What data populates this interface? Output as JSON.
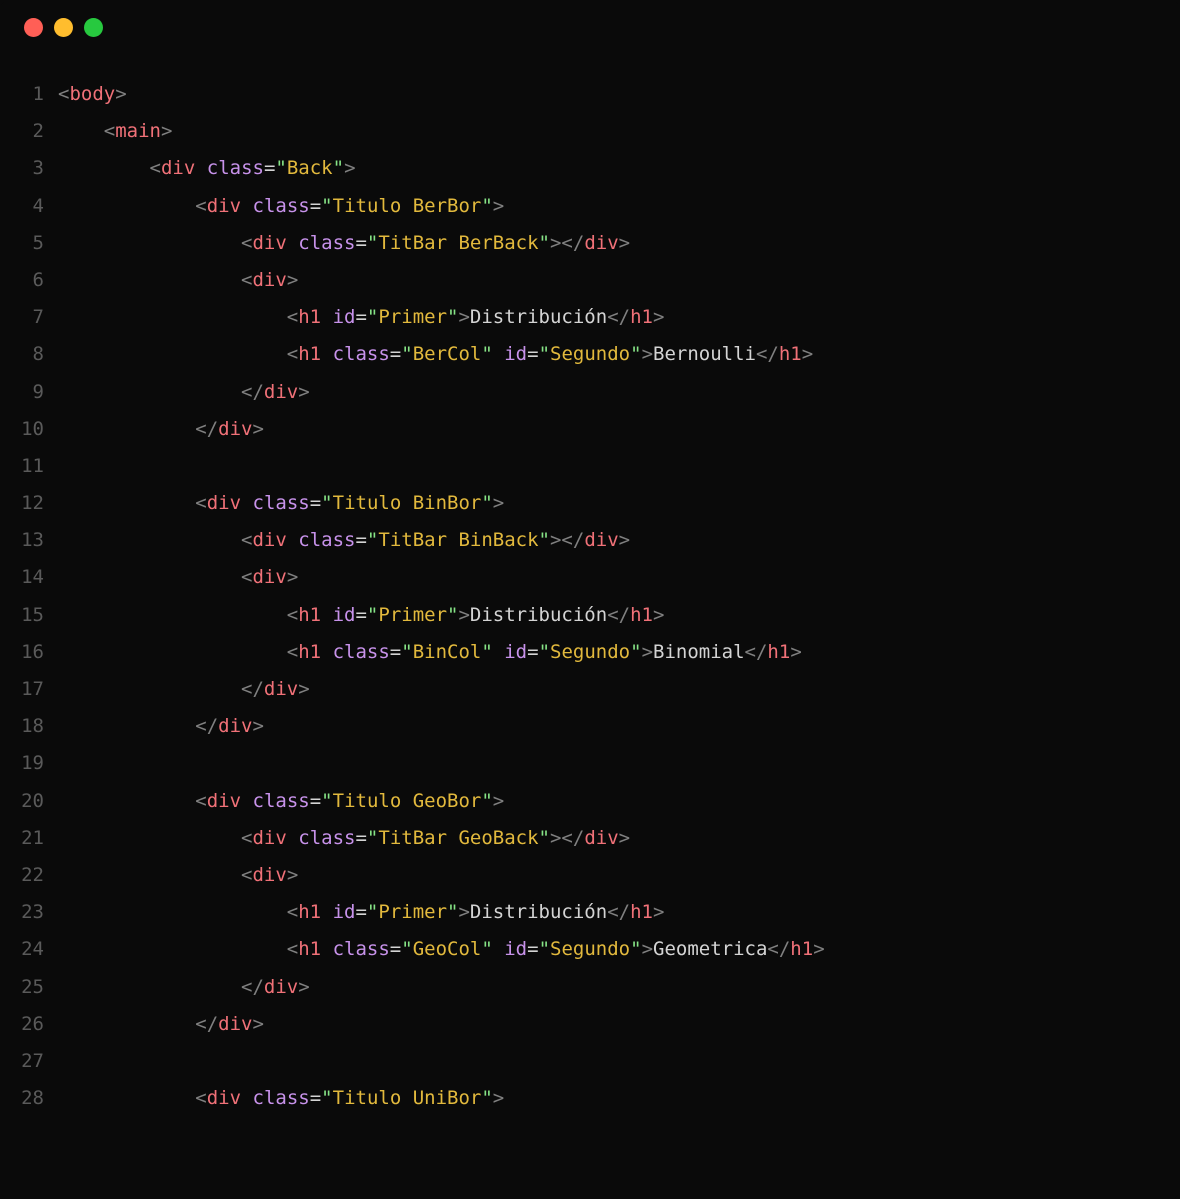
{
  "lines": [
    {
      "n": "1",
      "indent": 0,
      "tokens": [
        [
          "br",
          "<"
        ],
        [
          "tag",
          "body"
        ],
        [
          "br",
          ">"
        ]
      ]
    },
    {
      "n": "2",
      "indent": 1,
      "tokens": [
        [
          "br",
          "<"
        ],
        [
          "tag",
          "main"
        ],
        [
          "br",
          ">"
        ]
      ]
    },
    {
      "n": "3",
      "indent": 2,
      "tokens": [
        [
          "br",
          "<"
        ],
        [
          "tag",
          "div"
        ],
        [
          "txt",
          " "
        ],
        [
          "attn",
          "class"
        ],
        [
          "eq",
          "="
        ],
        [
          "q",
          "\""
        ],
        [
          "str",
          "Back"
        ],
        [
          "q",
          "\""
        ],
        [
          "br",
          ">"
        ]
      ]
    },
    {
      "n": "4",
      "indent": 3,
      "tokens": [
        [
          "br",
          "<"
        ],
        [
          "tag",
          "div"
        ],
        [
          "txt",
          " "
        ],
        [
          "attn",
          "class"
        ],
        [
          "eq",
          "="
        ],
        [
          "q",
          "\""
        ],
        [
          "str",
          "Titulo BerBor"
        ],
        [
          "q",
          "\""
        ],
        [
          "br",
          ">"
        ]
      ]
    },
    {
      "n": "5",
      "indent": 4,
      "tokens": [
        [
          "br",
          "<"
        ],
        [
          "tag",
          "div"
        ],
        [
          "txt",
          " "
        ],
        [
          "attn",
          "class"
        ],
        [
          "eq",
          "="
        ],
        [
          "q",
          "\""
        ],
        [
          "str",
          "TitBar BerBack"
        ],
        [
          "q",
          "\""
        ],
        [
          "br",
          "></"
        ],
        [
          "tag",
          "div"
        ],
        [
          "br",
          ">"
        ]
      ]
    },
    {
      "n": "6",
      "indent": 4,
      "tokens": [
        [
          "br",
          "<"
        ],
        [
          "tag",
          "div"
        ],
        [
          "br",
          ">"
        ]
      ]
    },
    {
      "n": "7",
      "indent": 5,
      "tokens": [
        [
          "br",
          "<"
        ],
        [
          "tag",
          "h1"
        ],
        [
          "txt",
          " "
        ],
        [
          "attn",
          "id"
        ],
        [
          "eq",
          "="
        ],
        [
          "q",
          "\""
        ],
        [
          "str",
          "Primer"
        ],
        [
          "q",
          "\""
        ],
        [
          "br",
          ">"
        ],
        [
          "txt",
          "Distribución"
        ],
        [
          "br",
          "</"
        ],
        [
          "tag",
          "h1"
        ],
        [
          "br",
          ">"
        ]
      ]
    },
    {
      "n": "8",
      "indent": 5,
      "tokens": [
        [
          "br",
          "<"
        ],
        [
          "tag",
          "h1"
        ],
        [
          "txt",
          " "
        ],
        [
          "attn",
          "class"
        ],
        [
          "eq",
          "="
        ],
        [
          "q",
          "\""
        ],
        [
          "str",
          "BerCol"
        ],
        [
          "q",
          "\""
        ],
        [
          "txt",
          " "
        ],
        [
          "attn",
          "id"
        ],
        [
          "eq",
          "="
        ],
        [
          "q",
          "\""
        ],
        [
          "str",
          "Segundo"
        ],
        [
          "q",
          "\""
        ],
        [
          "br",
          ">"
        ],
        [
          "txt",
          "Bernoulli"
        ],
        [
          "br",
          "</"
        ],
        [
          "tag",
          "h1"
        ],
        [
          "br",
          ">"
        ]
      ]
    },
    {
      "n": "9",
      "indent": 4,
      "tokens": [
        [
          "br",
          "</"
        ],
        [
          "tag",
          "div"
        ],
        [
          "br",
          ">"
        ]
      ]
    },
    {
      "n": "10",
      "indent": 3,
      "tokens": [
        [
          "br",
          "</"
        ],
        [
          "tag",
          "div"
        ],
        [
          "br",
          ">"
        ]
      ]
    },
    {
      "n": "11",
      "indent": 0,
      "tokens": []
    },
    {
      "n": "12",
      "indent": 3,
      "tokens": [
        [
          "br",
          "<"
        ],
        [
          "tag",
          "div"
        ],
        [
          "txt",
          " "
        ],
        [
          "attn",
          "class"
        ],
        [
          "eq",
          "="
        ],
        [
          "q",
          "\""
        ],
        [
          "str",
          "Titulo BinBor"
        ],
        [
          "q",
          "\""
        ],
        [
          "br",
          ">"
        ]
      ]
    },
    {
      "n": "13",
      "indent": 4,
      "tokens": [
        [
          "br",
          "<"
        ],
        [
          "tag",
          "div"
        ],
        [
          "txt",
          " "
        ],
        [
          "attn",
          "class"
        ],
        [
          "eq",
          "="
        ],
        [
          "q",
          "\""
        ],
        [
          "str",
          "TitBar BinBack"
        ],
        [
          "q",
          "\""
        ],
        [
          "br",
          "></"
        ],
        [
          "tag",
          "div"
        ],
        [
          "br",
          ">"
        ]
      ]
    },
    {
      "n": "14",
      "indent": 4,
      "tokens": [
        [
          "br",
          "<"
        ],
        [
          "tag",
          "div"
        ],
        [
          "br",
          ">"
        ]
      ]
    },
    {
      "n": "15",
      "indent": 5,
      "tokens": [
        [
          "br",
          "<"
        ],
        [
          "tag",
          "h1"
        ],
        [
          "txt",
          " "
        ],
        [
          "attn",
          "id"
        ],
        [
          "eq",
          "="
        ],
        [
          "q",
          "\""
        ],
        [
          "str",
          "Primer"
        ],
        [
          "q",
          "\""
        ],
        [
          "br",
          ">"
        ],
        [
          "txt",
          "Distribución"
        ],
        [
          "br",
          "</"
        ],
        [
          "tag",
          "h1"
        ],
        [
          "br",
          ">"
        ]
      ]
    },
    {
      "n": "16",
      "indent": 5,
      "tokens": [
        [
          "br",
          "<"
        ],
        [
          "tag",
          "h1"
        ],
        [
          "txt",
          " "
        ],
        [
          "attn",
          "class"
        ],
        [
          "eq",
          "="
        ],
        [
          "q",
          "\""
        ],
        [
          "str",
          "BinCol"
        ],
        [
          "q",
          "\""
        ],
        [
          "txt",
          " "
        ],
        [
          "attn",
          "id"
        ],
        [
          "eq",
          "="
        ],
        [
          "q",
          "\""
        ],
        [
          "str",
          "Segundo"
        ],
        [
          "q",
          "\""
        ],
        [
          "br",
          ">"
        ],
        [
          "txt",
          "Binomial"
        ],
        [
          "br",
          "</"
        ],
        [
          "tag",
          "h1"
        ],
        [
          "br",
          ">"
        ]
      ]
    },
    {
      "n": "17",
      "indent": 4,
      "tokens": [
        [
          "br",
          "</"
        ],
        [
          "tag",
          "div"
        ],
        [
          "br",
          ">"
        ]
      ]
    },
    {
      "n": "18",
      "indent": 3,
      "tokens": [
        [
          "br",
          "</"
        ],
        [
          "tag",
          "div"
        ],
        [
          "br",
          ">"
        ]
      ]
    },
    {
      "n": "19",
      "indent": 0,
      "tokens": []
    },
    {
      "n": "20",
      "indent": 3,
      "tokens": [
        [
          "br",
          "<"
        ],
        [
          "tag",
          "div"
        ],
        [
          "txt",
          " "
        ],
        [
          "attn",
          "class"
        ],
        [
          "eq",
          "="
        ],
        [
          "q",
          "\""
        ],
        [
          "str",
          "Titulo GeoBor"
        ],
        [
          "q",
          "\""
        ],
        [
          "br",
          ">"
        ]
      ]
    },
    {
      "n": "21",
      "indent": 4,
      "tokens": [
        [
          "br",
          "<"
        ],
        [
          "tag",
          "div"
        ],
        [
          "txt",
          " "
        ],
        [
          "attn",
          "class"
        ],
        [
          "eq",
          "="
        ],
        [
          "q",
          "\""
        ],
        [
          "str",
          "TitBar GeoBack"
        ],
        [
          "q",
          "\""
        ],
        [
          "br",
          "></"
        ],
        [
          "tag",
          "div"
        ],
        [
          "br",
          ">"
        ]
      ]
    },
    {
      "n": "22",
      "indent": 4,
      "tokens": [
        [
          "br",
          "<"
        ],
        [
          "tag",
          "div"
        ],
        [
          "br",
          ">"
        ]
      ]
    },
    {
      "n": "23",
      "indent": 5,
      "tokens": [
        [
          "br",
          "<"
        ],
        [
          "tag",
          "h1"
        ],
        [
          "txt",
          " "
        ],
        [
          "attn",
          "id"
        ],
        [
          "eq",
          "="
        ],
        [
          "q",
          "\""
        ],
        [
          "str",
          "Primer"
        ],
        [
          "q",
          "\""
        ],
        [
          "br",
          ">"
        ],
        [
          "txt",
          "Distribución"
        ],
        [
          "br",
          "</"
        ],
        [
          "tag",
          "h1"
        ],
        [
          "br",
          ">"
        ]
      ]
    },
    {
      "n": "24",
      "indent": 5,
      "tokens": [
        [
          "br",
          "<"
        ],
        [
          "tag",
          "h1"
        ],
        [
          "txt",
          " "
        ],
        [
          "attn",
          "class"
        ],
        [
          "eq",
          "="
        ],
        [
          "q",
          "\""
        ],
        [
          "str",
          "GeoCol"
        ],
        [
          "q",
          "\""
        ],
        [
          "txt",
          " "
        ],
        [
          "attn",
          "id"
        ],
        [
          "eq",
          "="
        ],
        [
          "q",
          "\""
        ],
        [
          "str",
          "Segundo"
        ],
        [
          "q",
          "\""
        ],
        [
          "br",
          ">"
        ],
        [
          "txt",
          "Geometrica"
        ],
        [
          "br",
          "</"
        ],
        [
          "tag",
          "h1"
        ],
        [
          "br",
          ">"
        ]
      ]
    },
    {
      "n": "25",
      "indent": 4,
      "tokens": [
        [
          "br",
          "</"
        ],
        [
          "tag",
          "div"
        ],
        [
          "br",
          ">"
        ]
      ]
    },
    {
      "n": "26",
      "indent": 3,
      "tokens": [
        [
          "br",
          "</"
        ],
        [
          "tag",
          "div"
        ],
        [
          "br",
          ">"
        ]
      ]
    },
    {
      "n": "27",
      "indent": 0,
      "tokens": []
    },
    {
      "n": "28",
      "indent": 3,
      "tokens": [
        [
          "br",
          "<"
        ],
        [
          "tag",
          "div"
        ],
        [
          "txt",
          " "
        ],
        [
          "attn",
          "class"
        ],
        [
          "eq",
          "="
        ],
        [
          "q",
          "\""
        ],
        [
          "str",
          "Titulo UniBor"
        ],
        [
          "q",
          "\""
        ],
        [
          "br",
          ">"
        ]
      ]
    }
  ]
}
